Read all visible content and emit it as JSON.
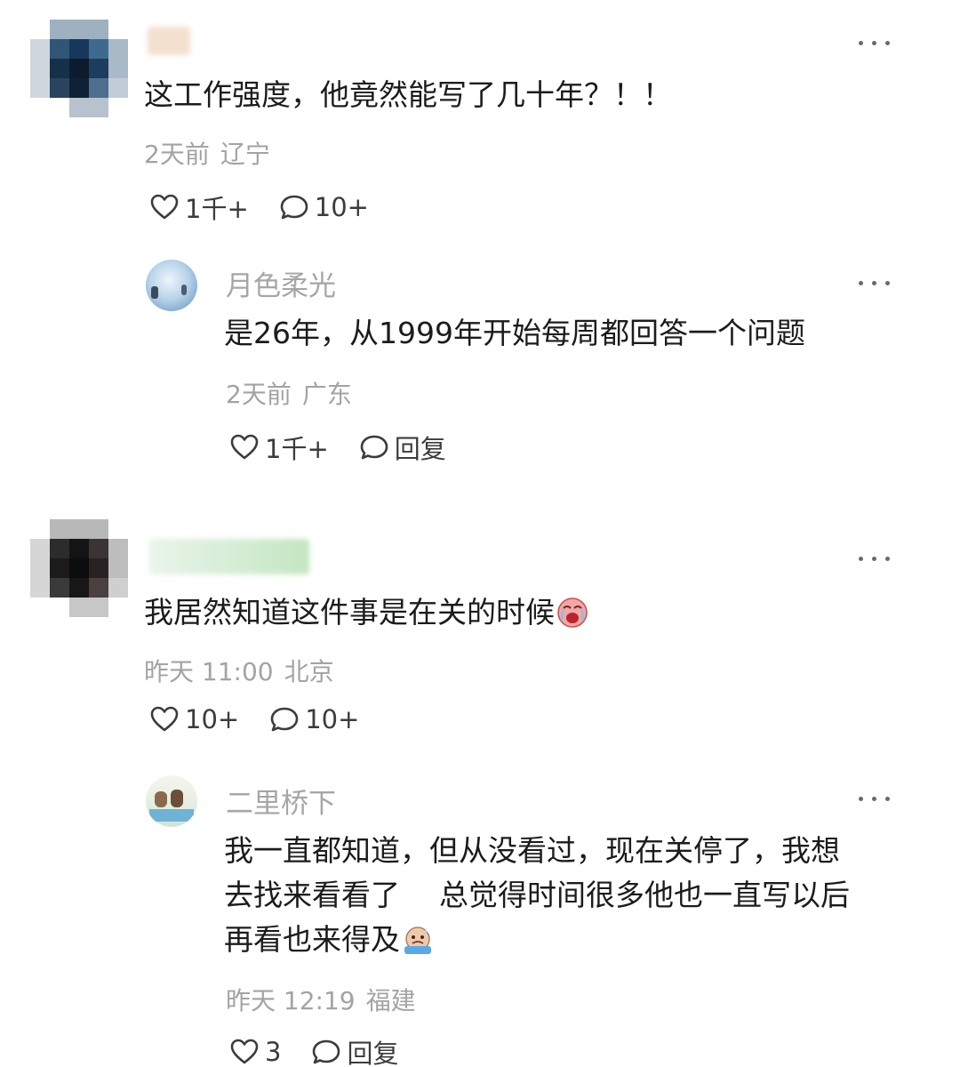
{
  "comments": [
    {
      "text": "这工作强度，他竟然能写了几十年？！！",
      "time": "2天前",
      "location": "辽宁",
      "likes": "1千+",
      "reply_count": "10+",
      "reply": {
        "username": "月色柔光",
        "text": "是26年，从1999年开始每周都回答一个问题",
        "time": "2天前",
        "location": "广东",
        "likes": "1千+",
        "reply_label": "回复"
      }
    },
    {
      "text": "我居然知道这件事是在关的时候",
      "time": "昨天 11:00",
      "location": "北京",
      "likes": "10+",
      "reply_count": "10+",
      "reply": {
        "username": "二里桥下",
        "text_line1": "我一直都知道，但从没看过，现在关停了，我想",
        "text_line2a": "去找来看看了",
        "text_line2b": "总觉得时间很多他也一直写以后",
        "text_line3": "再看也来得及",
        "time": "昨天 12:19",
        "location": "福建",
        "likes": "3",
        "reply_label": "回复"
      }
    }
  ],
  "icons": {
    "like": "heart-outline-icon",
    "comment": "speech-bubble-icon",
    "more": "more-dots-icon",
    "emoji_1": "crying-face-emoji",
    "emoji_2": "sweating-face-emoji"
  },
  "colors": {
    "text": "#1c1c1c",
    "meta": "#a3a3a3",
    "username": "#a6a6a6",
    "action": "#3c3c3c"
  }
}
